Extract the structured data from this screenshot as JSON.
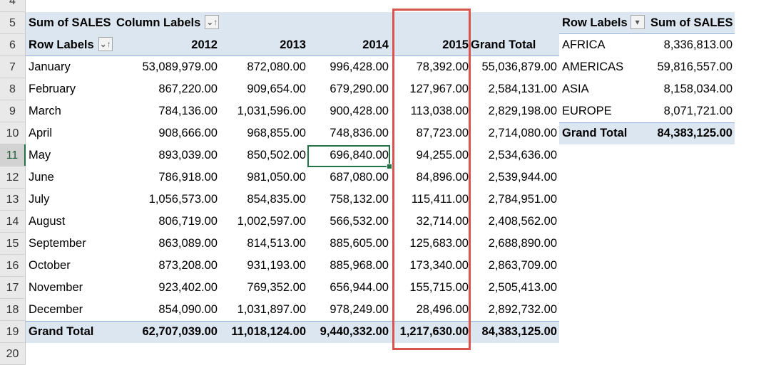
{
  "row_headers": [
    "4",
    "5",
    "6",
    "7",
    "8",
    "9",
    "10",
    "11",
    "12",
    "13",
    "14",
    "15",
    "16",
    "17",
    "18",
    "19",
    "20"
  ],
  "selected_row": "11",
  "pivot_main": {
    "value_field": "Sum of SALES",
    "column_labels": "Column Labels",
    "row_labels": "Row Labels",
    "columns": [
      "2012",
      "2013",
      "2014",
      "2015",
      "Grand Total"
    ],
    "rows": [
      {
        "label": "January",
        "values": [
          "53,089,979.00",
          "872,080.00",
          "996,428.00",
          "78,392.00",
          "55,036,879.00"
        ]
      },
      {
        "label": "February",
        "values": [
          "867,220.00",
          "909,654.00",
          "679,290.00",
          "127,967.00",
          "2,584,131.00"
        ]
      },
      {
        "label": "March",
        "values": [
          "784,136.00",
          "1,031,596.00",
          "900,428.00",
          "113,038.00",
          "2,829,198.00"
        ]
      },
      {
        "label": "April",
        "values": [
          "908,666.00",
          "968,855.00",
          "748,836.00",
          "87,723.00",
          "2,714,080.00"
        ]
      },
      {
        "label": "May",
        "values": [
          "893,039.00",
          "850,502.00",
          "696,840.00",
          "94,255.00",
          "2,534,636.00"
        ]
      },
      {
        "label": "June",
        "values": [
          "786,918.00",
          "981,050.00",
          "687,080.00",
          "84,896.00",
          "2,539,944.00"
        ]
      },
      {
        "label": "July",
        "values": [
          "1,056,573.00",
          "854,835.00",
          "758,132.00",
          "115,411.00",
          "2,784,951.00"
        ]
      },
      {
        "label": "August",
        "values": [
          "806,719.00",
          "1,002,597.00",
          "566,532.00",
          "32,714.00",
          "2,408,562.00"
        ]
      },
      {
        "label": "September",
        "values": [
          "863,089.00",
          "814,513.00",
          "885,605.00",
          "125,683.00",
          "2,688,890.00"
        ]
      },
      {
        "label": "October",
        "values": [
          "873,208.00",
          "931,193.00",
          "885,968.00",
          "173,340.00",
          "2,863,709.00"
        ]
      },
      {
        "label": "November",
        "values": [
          "923,402.00",
          "769,352.00",
          "656,944.00",
          "155,715.00",
          "2,505,413.00"
        ]
      },
      {
        "label": "December",
        "values": [
          "854,090.00",
          "1,031,897.00",
          "978,249.00",
          "28,496.00",
          "2,892,732.00"
        ]
      }
    ],
    "grand_total": {
      "label": "Grand Total",
      "values": [
        "62,707,039.00",
        "11,018,124.00",
        "9,440,332.00",
        "1,217,630.00",
        "84,383,125.00"
      ]
    }
  },
  "pivot_region": {
    "row_labels": "Row Labels",
    "value_field": "Sum of SALES",
    "rows": [
      {
        "label": "AFRICA",
        "value": "8,336,813.00"
      },
      {
        "label": "AMERICAS",
        "value": "59,816,557.00"
      },
      {
        "label": "ASIA",
        "value": "8,158,034.00"
      },
      {
        "label": "EUROPE",
        "value": "8,071,721.00"
      }
    ],
    "grand_total": {
      "label": "Grand Total",
      "value": "84,383,125.00"
    }
  },
  "icons": {
    "sort_filter": "⌄↑",
    "dropdown": "▾"
  },
  "highlight_color": "#d9534f",
  "selection_color": "#217346"
}
